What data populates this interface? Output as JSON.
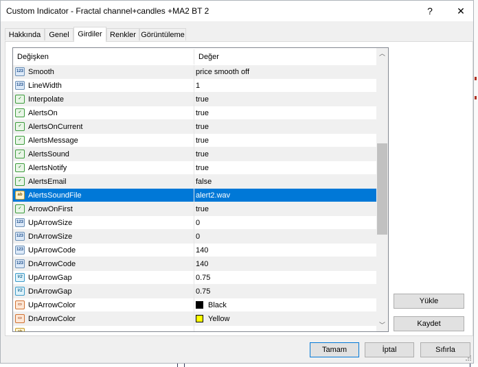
{
  "window": {
    "title": "Custom Indicator - Fractal channel+candles +MA2  BT 2",
    "help_glyph": "?",
    "close_glyph": "✕"
  },
  "tabs": [
    {
      "label": "Hakkında",
      "active": false
    },
    {
      "label": "Genel",
      "active": false
    },
    {
      "label": "Girdiler",
      "active": true
    },
    {
      "label": "Renkler",
      "active": false
    },
    {
      "label": "Görüntüleme",
      "active": false
    }
  ],
  "grid": {
    "columns": {
      "name": "Değişken",
      "value": "Değer"
    },
    "rows": [
      {
        "icon": "number-icon",
        "icon_text": "123",
        "kind": "num",
        "name": "Smooth",
        "value": "price smooth off",
        "state": "alt"
      },
      {
        "icon": "number-icon",
        "icon_text": "123",
        "kind": "num",
        "name": "LineWidth",
        "value": "1",
        "state": ""
      },
      {
        "icon": "boolean-icon",
        "icon_text": "✓",
        "kind": "bool",
        "name": "Interpolate",
        "value": "true",
        "state": "alt"
      },
      {
        "icon": "boolean-icon",
        "icon_text": "✓",
        "kind": "bool",
        "name": "AlertsOn",
        "value": "true",
        "state": ""
      },
      {
        "icon": "boolean-icon",
        "icon_text": "✓",
        "kind": "bool",
        "name": "AlertsOnCurrent",
        "value": "true",
        "state": "alt"
      },
      {
        "icon": "boolean-icon",
        "icon_text": "✓",
        "kind": "bool",
        "name": "AlertsMessage",
        "value": "true",
        "state": ""
      },
      {
        "icon": "boolean-icon",
        "icon_text": "✓",
        "kind": "bool",
        "name": "AlertsSound",
        "value": "true",
        "state": "alt"
      },
      {
        "icon": "boolean-icon",
        "icon_text": "✓",
        "kind": "bool",
        "name": "AlertsNotify",
        "value": "true",
        "state": ""
      },
      {
        "icon": "boolean-icon",
        "icon_text": "✓",
        "kind": "bool",
        "name": "AlertsEmail",
        "value": "false",
        "state": "alt"
      },
      {
        "icon": "string-icon",
        "icon_text": "ab",
        "kind": "str",
        "name": "AlertsSoundFile",
        "value": "alert2.wav",
        "state": "sel"
      },
      {
        "icon": "boolean-icon",
        "icon_text": "✓",
        "kind": "bool",
        "name": "ArrowOnFirst",
        "value": "true",
        "state": "alt"
      },
      {
        "icon": "number-icon",
        "icon_text": "123",
        "kind": "num",
        "name": "UpArrowSize",
        "value": "0",
        "state": ""
      },
      {
        "icon": "number-icon",
        "icon_text": "123",
        "kind": "num",
        "name": "DnArrowSize",
        "value": "0",
        "state": "alt"
      },
      {
        "icon": "number-icon",
        "icon_text": "123",
        "kind": "num",
        "name": "UpArrowCode",
        "value": "140",
        "state": ""
      },
      {
        "icon": "number-icon",
        "icon_text": "123",
        "kind": "num",
        "name": "DnArrowCode",
        "value": "140",
        "state": "alt"
      },
      {
        "icon": "double-icon",
        "icon_text": "V2",
        "kind": "dbl",
        "name": "UpArrowGap",
        "value": "0.75",
        "state": ""
      },
      {
        "icon": "double-icon",
        "icon_text": "V2",
        "kind": "dbl",
        "name": "DnArrowGap",
        "value": "0.75",
        "state": "alt"
      },
      {
        "icon": "color-icon",
        "icon_text": "▭",
        "kind": "col",
        "name": "UpArrowColor",
        "value": "Black",
        "swatch": "#000000",
        "state": ""
      },
      {
        "icon": "color-icon",
        "icon_text": "▭",
        "kind": "col",
        "name": "DnArrowColor",
        "value": "Yellow",
        "swatch": "#ffff00",
        "state": "alt"
      },
      {
        "icon": "string-icon",
        "icon_text": "ab",
        "kind": "str",
        "name": "",
        "value": "",
        "state": ""
      }
    ],
    "scroll": {
      "up_glyph": "︿",
      "down_glyph": "﹀"
    }
  },
  "side_buttons": {
    "load": "Yükle",
    "save": "Kaydet"
  },
  "footer_buttons": {
    "ok": "Tamam",
    "cancel": "İptal",
    "reset": "Sıfırla"
  },
  "colors": {
    "selection": "#0078d7",
    "accent_border": "#0078d7"
  }
}
